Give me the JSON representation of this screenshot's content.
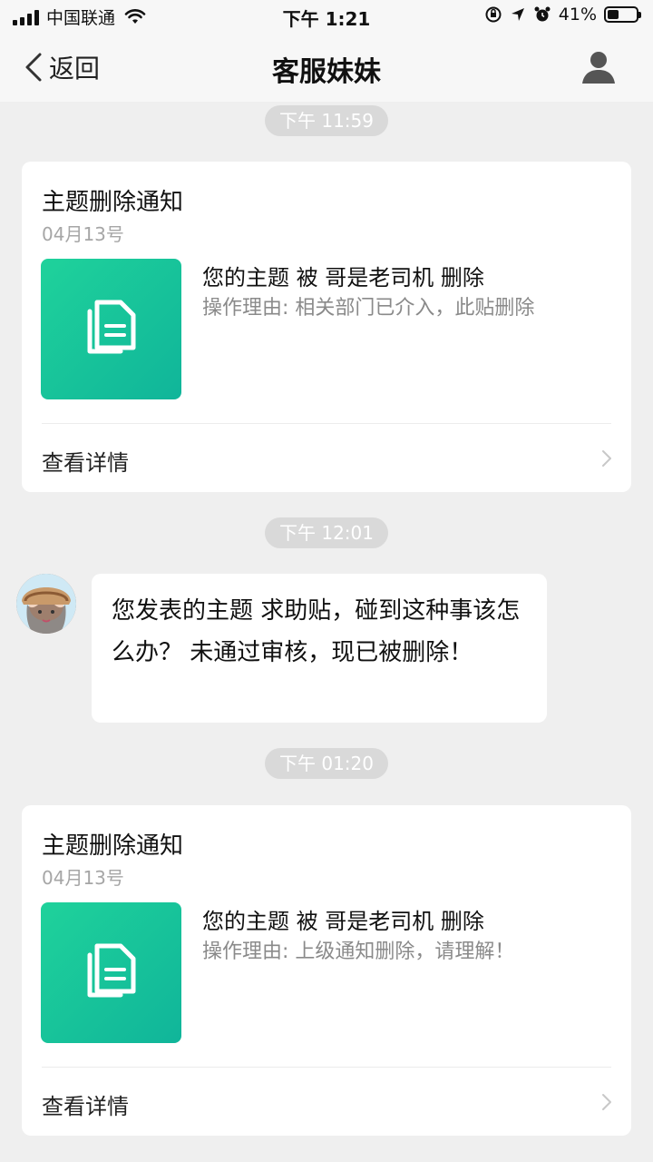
{
  "status_bar": {
    "carrier": "中国联通",
    "time": "下午 1:21",
    "battery": "41%",
    "battery_level": 0.41
  },
  "nav": {
    "back_label": "返回",
    "title": "客服妹妹"
  },
  "messages": {
    "time1": "下午 11:59",
    "card1": {
      "title": "主题删除通知",
      "date": "04月13号",
      "headline": "您的主题  被 哥是老司机 删除",
      "reason": "操作理由:  相关部门已介入，此贴删除",
      "footer": "查看详情"
    },
    "time2": "下午 12:01",
    "chat": {
      "text": "您发表的主题 求助贴，碰到这种事该怎么办？ 未通过审核，现已被删除！"
    },
    "time3": "下午 01:20",
    "card2": {
      "title": "主题删除通知",
      "date": "04月13号",
      "headline": "您的主题  被 哥是老司机 删除",
      "reason": "操作理由:  上级通知删除，请理解！",
      "footer": "查看详情"
    }
  },
  "icons": {
    "signal": "signal-icon",
    "wifi": "wifi-icon",
    "lock_rotation": "orientation-lock-icon",
    "location": "location-arrow-icon",
    "alarm": "alarm-icon",
    "battery": "battery-icon",
    "back": "chevron-left-icon",
    "profile": "person-icon",
    "document": "document-icon",
    "chevron_right": "chevron-right-icon"
  },
  "colors": {
    "accent_green": "#1fd29b",
    "background": "#efefef",
    "time_pill": "#d9d9d9"
  }
}
